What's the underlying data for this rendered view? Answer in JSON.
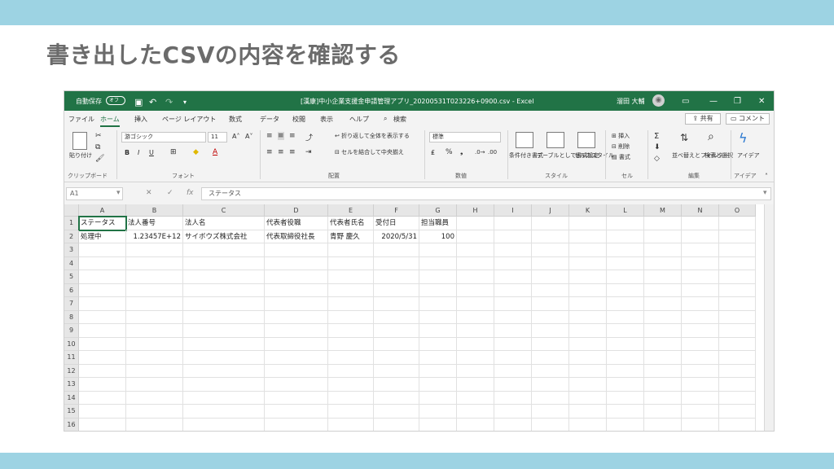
{
  "slide": {
    "title": "書き出したCSVの内容を確認する"
  },
  "titlebar": {
    "autosave_label": "自動保存",
    "autosave_state": "オフ",
    "document_title": "[漢康]中小企業支援金申請管理アプリ_20200531T023226+0900.csv  -  Excel",
    "user_name": "溜田 大輔",
    "colors": {
      "bar": "#217346"
    }
  },
  "tabs": {
    "items": [
      "ファイル",
      "ホーム",
      "挿入",
      "ページ レイアウト",
      "数式",
      "データ",
      "校閲",
      "表示",
      "ヘルプ",
      "検索"
    ],
    "active": "ホーム",
    "share_label": "共有",
    "comment_label": "コメント"
  },
  "ribbon": {
    "clipboard": {
      "paste_label": "貼り付け",
      "group_label": "クリップボード"
    },
    "font": {
      "font_name": "游ゴシック",
      "font_size": "11",
      "group_label": "フォント"
    },
    "alignment": {
      "wrap_label": "折り返して全体を表示する",
      "merge_label": "セルを結合して中央揃え",
      "group_label": "配置"
    },
    "number": {
      "format": "標準",
      "group_label": "数値"
    },
    "styles": {
      "conditional_label": "条件付き書式",
      "table_label": "テーブルとして書式設定",
      "cell_style_label": "セルのスタイル",
      "group_label": "スタイル"
    },
    "cells": {
      "insert_label": "挿入",
      "delete_label": "削除",
      "format_label": "書式",
      "group_label": "セル"
    },
    "editing": {
      "sort_label": "並べ替えとフィルター",
      "find_label": "検索と選択",
      "group_label": "編集"
    },
    "ideas": {
      "label": "アイデア",
      "group_label": "アイデア"
    }
  },
  "formula_bar": {
    "name_box": "A1",
    "content": "ステータス"
  },
  "sheet": {
    "columns": [
      "A",
      "B",
      "C",
      "D",
      "E",
      "F",
      "G",
      "H",
      "I",
      "J",
      "K",
      "L",
      "M",
      "N",
      "O"
    ],
    "row_numbers": [
      "1",
      "2",
      "3",
      "4",
      "5",
      "6",
      "7",
      "8",
      "9",
      "10",
      "11",
      "12",
      "13",
      "14",
      "15",
      "16"
    ],
    "rows": [
      [
        "ステータス",
        "法人番号",
        "法人名",
        "代表者役職",
        "代表者氏名",
        "受付日",
        "担当職員"
      ],
      [
        "処理中",
        "1.23457E+12",
        "サイボウズ株式会社",
        "代表取締役社長",
        "青野 慶久",
        "2020/5/31",
        "100"
      ]
    ],
    "numeric_cells": [
      [
        1,
        1
      ],
      [
        1,
        5
      ],
      [
        1,
        6
      ]
    ]
  }
}
